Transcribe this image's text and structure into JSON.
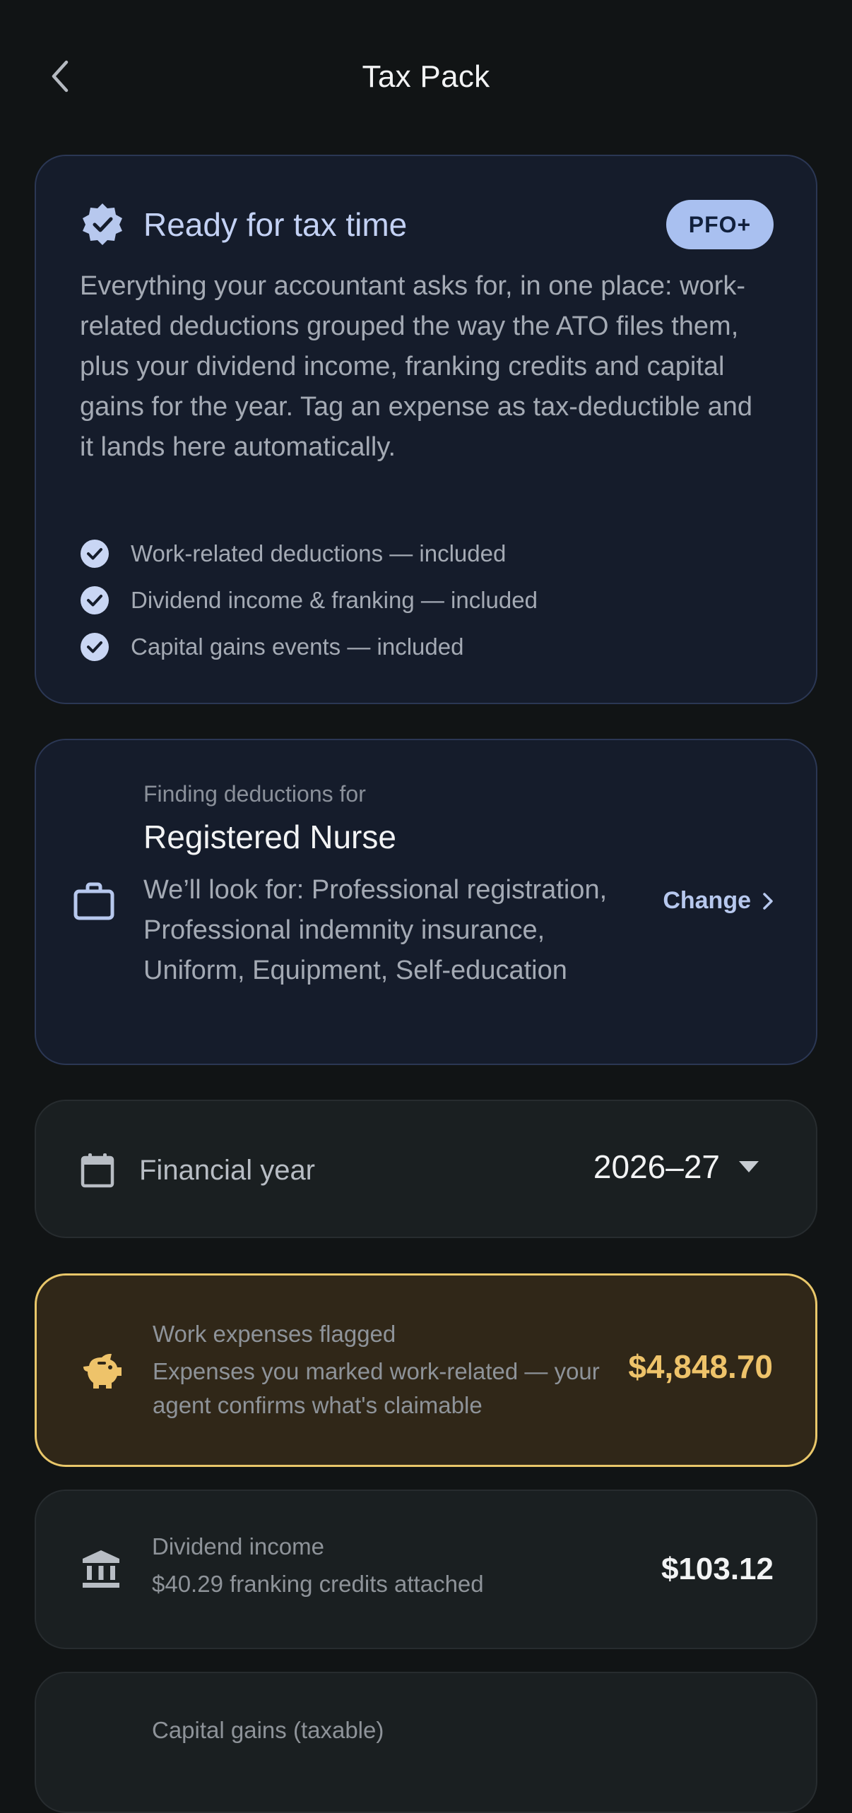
{
  "header": {
    "title": "Tax Pack",
    "back_icon": "chevron-left-icon"
  },
  "ready_card": {
    "icon": "verified-badge-icon",
    "title": "Ready for tax time",
    "badge": "PFO+",
    "description": "Everything your accountant asks for, in one place: work-related deductions grouped the way the ATO files them, plus your dividend income, franking credits and capital gains for the year. Tag an expense as tax-deductible and it lands here automatically.",
    "checks": [
      "Work-related deductions — included",
      "Dividend income & franking — included",
      "Capital gains events — included"
    ]
  },
  "occupation_card": {
    "icon": "briefcase-icon",
    "kicker": "Finding deductions for",
    "occupation": "Registered Nurse",
    "description": "We’ll look for: Professional registration, Professional indemnity insurance, Uniform, Equipment, Self-education",
    "change_label": "Change"
  },
  "financial_year": {
    "icon": "calendar-icon",
    "label": "Financial year",
    "value": "2026–27"
  },
  "work_expenses": {
    "icon": "piggy-bank-icon",
    "kicker": "Work expenses flagged",
    "subtitle": "Expenses you marked work-related — your agent confirms what's claimable",
    "amount": "$4,848.70"
  },
  "dividend_income": {
    "icon": "bank-icon",
    "kicker": "Dividend income",
    "subtitle": "$40.29 franking credits attached",
    "amount": "$103.12"
  },
  "capital_gains": {
    "kicker": "Capital gains (taxable)"
  },
  "colors": {
    "background": "#111415",
    "accent_blue": "#a9c0f0",
    "accent_gold": "#eec36a"
  }
}
